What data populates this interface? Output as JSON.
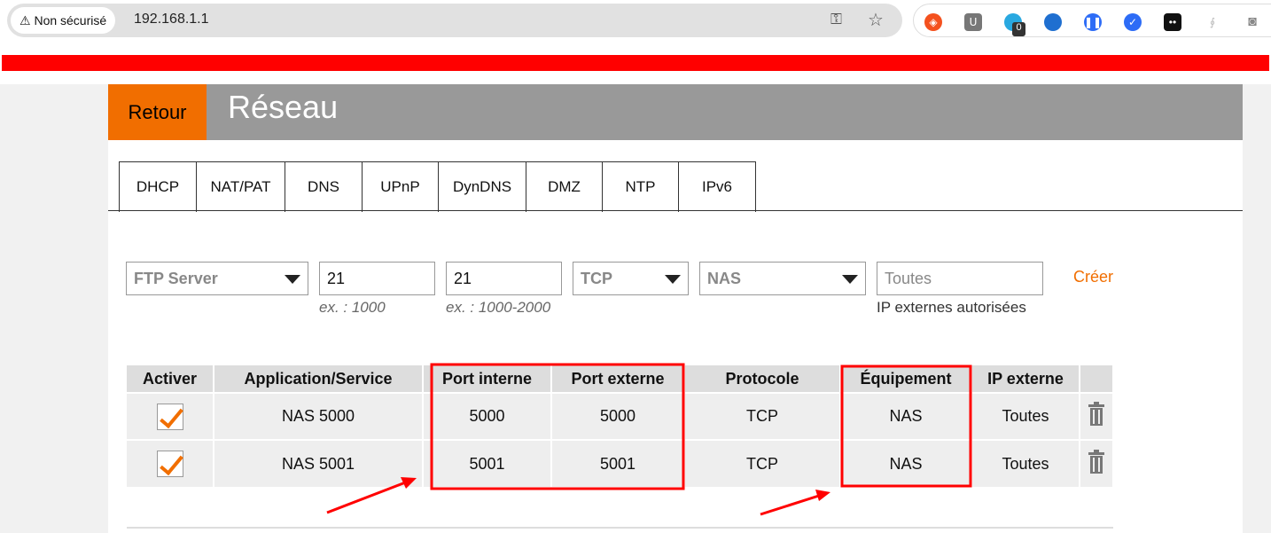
{
  "browser": {
    "security_label": "Non sécurisé",
    "url": "192.168.1.1",
    "extension_badge": "0"
  },
  "header": {
    "back_label": "Retour",
    "title": "Réseau"
  },
  "tabs": [
    {
      "label": "DHCP"
    },
    {
      "label": "NAT/PAT",
      "active": true
    },
    {
      "label": "DNS"
    },
    {
      "label": "UPnP"
    },
    {
      "label": "DynDNS"
    },
    {
      "label": "DMZ"
    },
    {
      "label": "NTP"
    },
    {
      "label": "IPv6"
    }
  ],
  "form": {
    "service": "FTP Server",
    "internal_port": "21",
    "internal_hint": "ex. : 1000",
    "external_port": "21",
    "external_hint": "ex. : 1000-2000",
    "protocol": "TCP",
    "device": "NAS",
    "ip_placeholder": "Toutes",
    "ip_hint": "IP externes autorisées",
    "create_label": "Créer"
  },
  "table": {
    "headers": [
      "Activer",
      "Application/Service",
      "Port interne",
      "Port externe",
      "Protocole",
      "Équipement",
      "IP externe",
      ""
    ],
    "rows": [
      {
        "enabled": true,
        "service": "NAS 5000",
        "internal": "5000",
        "external": "5000",
        "protocol": "TCP",
        "device": "NAS",
        "ip": "Toutes"
      },
      {
        "enabled": true,
        "service": "NAS 5001",
        "internal": "5001",
        "external": "5001",
        "protocol": "TCP",
        "device": "NAS",
        "ip": "Toutes"
      }
    ]
  },
  "colors": {
    "accent": "#f16e00",
    "annotation": "#ff0000"
  }
}
